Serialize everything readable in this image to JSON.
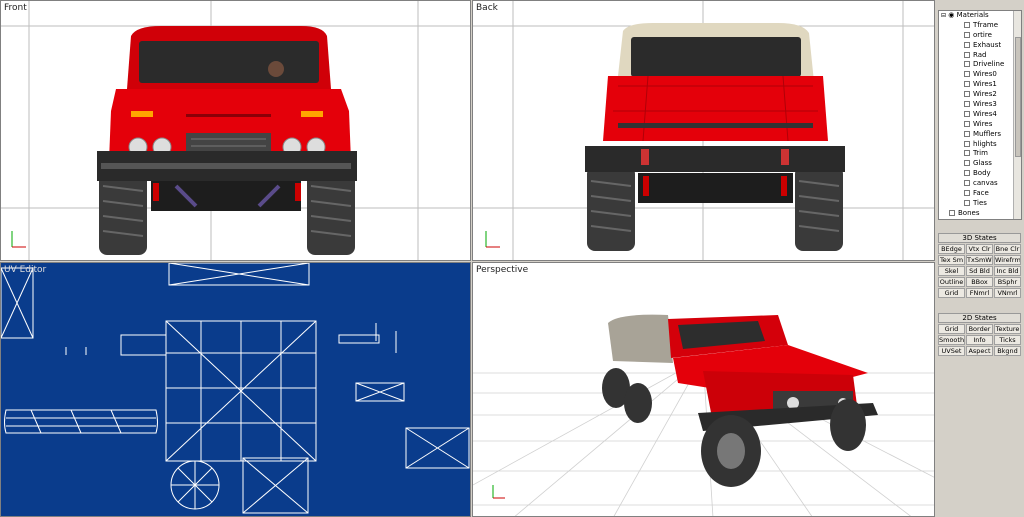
{
  "viewports": {
    "front": {
      "label": "Front"
    },
    "back": {
      "label": "Back"
    },
    "uv": {
      "label": "UV Editor"
    },
    "perspective": {
      "label": "Perspective"
    }
  },
  "tree": {
    "root": "Materials",
    "items": [
      "Tframe",
      "ortire",
      "Exhaust",
      "Rad",
      "Driveline",
      "Wires0",
      "Wires1",
      "Wires2",
      "Wires3",
      "Wires4",
      "Wires",
      "Mufflers",
      "hlights",
      "Trim",
      "Glass",
      "Body",
      "canvas",
      "Face",
      "Ties"
    ],
    "bones": "Bones"
  },
  "states3d": {
    "title": "3D States",
    "buttons": [
      "BEdge",
      "Vtx Clr",
      "Bne Clr",
      "Tex Sm",
      "TxSmWr",
      "Wirefrm",
      "Skel",
      "Sd Bld",
      "Inc Bld",
      "Outline",
      "BBox",
      "BSphr",
      "Grid",
      "FNmrl",
      "VNmrl"
    ]
  },
  "states2d": {
    "title": "2D States",
    "buttons": [
      "Grid",
      "Border",
      "Texture",
      "Smooth",
      "Info",
      "Ticks",
      "UVSet",
      "Aspect",
      "Bkgnd"
    ]
  },
  "colors": {
    "body_red": "#e4000a",
    "uv_bg": "#0a3c8c",
    "viewport_bg": "#ffffff",
    "panel": "#d4d0c8"
  }
}
